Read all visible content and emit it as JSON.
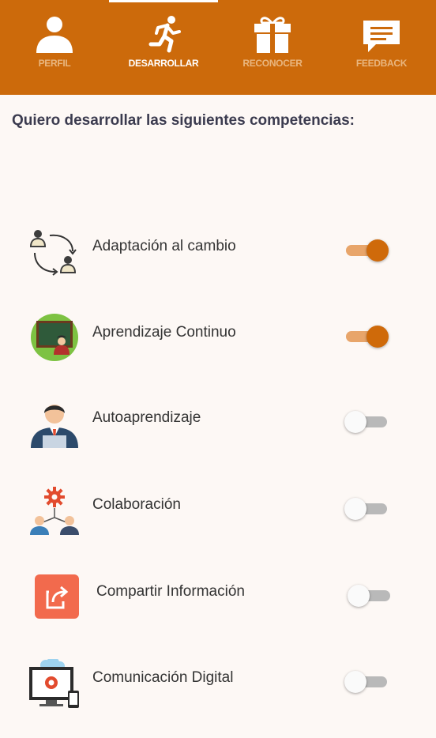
{
  "nav": {
    "tabs": [
      {
        "label": "PERFIL",
        "icon": "user-icon",
        "active": false
      },
      {
        "label": "DESARROLLAR",
        "icon": "running-person-icon",
        "active": true
      },
      {
        "label": "RECONOCER",
        "icon": "gift-icon",
        "active": false
      },
      {
        "label": "FEEDBACK",
        "icon": "chat-bubble-icon",
        "active": false
      }
    ],
    "colors": {
      "bar": "#cc6a0b",
      "active_text": "#ffffff",
      "inactive_text": "#e9b67f"
    }
  },
  "heading": "Quiero desarrollar las siguientes competencias:",
  "competencies": [
    {
      "name": "Adaptación al cambio",
      "icon": "adaptation-icon",
      "enabled": true
    },
    {
      "name": "Aprendizaje Continuo",
      "icon": "classroom-icon",
      "enabled": true
    },
    {
      "name": "Autoaprendizaje",
      "icon": "businessman-icon",
      "enabled": false
    },
    {
      "name": "Colaboración",
      "icon": "collaboration-icon",
      "enabled": false
    },
    {
      "name": "Compartir Información",
      "icon": "share-icon",
      "enabled": false
    },
    {
      "name": "Comunicación Digital",
      "icon": "digital-communication-icon",
      "enabled": false
    }
  ],
  "toggle_colors": {
    "on_knob": "#cf6a0a",
    "on_track": "#e8a56a",
    "off_knob": "#fafafa",
    "off_track": "#b9b9b9"
  }
}
